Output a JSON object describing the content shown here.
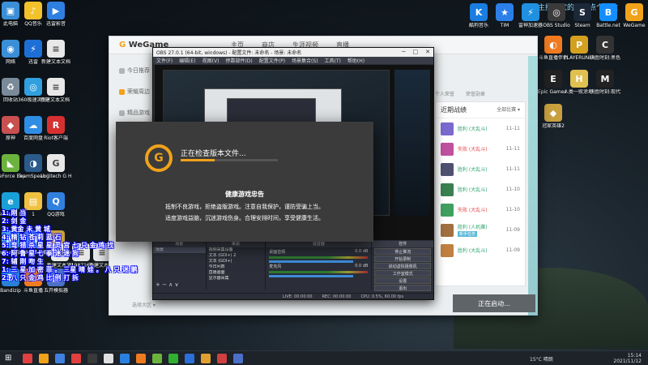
{
  "banner": {
    "text": "曾洁主播喜欢的可以点个关注"
  },
  "desktop_left": [
    {
      "label": "此电脑",
      "color": "#3a8fd6",
      "glyph": "▣"
    },
    {
      "label": "QQ音乐",
      "color": "#f3c12b",
      "glyph": "♪"
    },
    {
      "label": "迅雷影音",
      "color": "#2f7fe0",
      "glyph": "▶"
    },
    {
      "label": "网络",
      "color": "#3a8fd6",
      "glyph": "◉"
    },
    {
      "label": "迅雷",
      "color": "#1d6fd6",
      "glyph": "⚡"
    },
    {
      "label": "新建文本文档",
      "color": "#e8e8e8",
      "glyph": "≡"
    },
    {
      "label": "回收站",
      "color": "#7a8a99",
      "glyph": "♻"
    },
    {
      "label": "360极速浏览器",
      "color": "#30a0e0",
      "glyph": "◎"
    },
    {
      "label": "新建文本文档 (2)",
      "color": "#e8e8e8",
      "glyph": "≡"
    },
    {
      "label": "原神",
      "color": "#c85050",
      "glyph": "◆"
    },
    {
      "label": "百度网盘",
      "color": "#2f8de4",
      "glyph": "☁"
    },
    {
      "label": "Riot客户端",
      "color": "#d73030",
      "glyph": "R"
    },
    {
      "label": "GeForce Experience",
      "color": "#6cb33e",
      "glyph": "◣"
    },
    {
      "label": "TeamSpeak 3",
      "color": "#2a5b8a",
      "glyph": "◑"
    },
    {
      "label": "Logitech G HUB",
      "color": "#e8e8e8",
      "glyph": "G"
    },
    {
      "label": "Microsoft Edge",
      "color": "#1aa0d8",
      "glyph": "e"
    },
    {
      "label": "1",
      "color": "#f0c040",
      "glyph": "▤"
    },
    {
      "label": "QQ游戏",
      "color": "#3080e0",
      "glyph": "Q"
    },
    {
      "label": "MuMu模拟器",
      "color": "#4aa0e8",
      "glyph": "M"
    },
    {
      "label": "MuMu多开器",
      "color": "#4a8ae8",
      "glyph": "M"
    },
    {
      "label": "League of Legends",
      "color": "#c8a040",
      "glyph": "L"
    },
    {
      "label": "Bandizip",
      "color": "#2a80d8",
      "glyph": "B"
    },
    {
      "label": "斗鱼直播",
      "color": "#f07a20",
      "glyph": "◐"
    },
    {
      "label": "五开模拟器",
      "color": "#4a70c8",
      "glyph": "▦"
    }
  ],
  "desktop_middle": [
    {
      "label": "新建文本文档 (2)"
    },
    {
      "label": "d198716dcf5..."
    },
    {
      "label": "新建文本文档"
    }
  ],
  "desktop_top_right": [
    {
      "label": "酷狗音乐",
      "color": "#1a7de0",
      "glyph": "K"
    },
    {
      "label": "TIM",
      "color": "#2d7fe8",
      "glyph": "★"
    },
    {
      "label": "雷神加速器",
      "color": "#2090e0",
      "glyph": "⚡"
    },
    {
      "label": "OBS Studio",
      "color": "#3a3a3a",
      "glyph": "◎"
    },
    {
      "label": "Steam",
      "color": "#1b2838",
      "glyph": "S"
    },
    {
      "label": "Battle.net",
      "color": "#148eff",
      "glyph": "B"
    },
    {
      "label": "WeGame",
      "color": "#f0a21a",
      "glyph": "G"
    }
  ],
  "desktop_right": [
    {
      "label": "斗鱼直播伴侣",
      "color": "#f07a20",
      "glyph": "◐"
    },
    {
      "label": "PLAYERUNKNOWN'S BATTLEGR...",
      "color": "#d4a020",
      "glyph": "P"
    },
    {
      "label": "决胜时刻:黑色行动冷战",
      "color": "#333",
      "glyph": "C"
    },
    {
      "label": "Epic Games Launcher",
      "color": "#222",
      "glyph": "E"
    },
    {
      "label": "人类一败涂地 Human Fall Flat",
      "color": "#e0c050",
      "glyph": "H"
    },
    {
      "label": "决胜时刻:现代战争",
      "color": "#222",
      "glyph": "M"
    },
    {
      "label": "冠家英雄2",
      "color": "#c8a040",
      "glyph": "◆"
    }
  ],
  "overlay_lines": [
    "1: 刚  当",
    "2: 剑  金",
    "3: 黄金  未  黄  城",
    "4: 精  钻  苍  莉  蓝  石",
    "5:  弯  猎  杀  星  星  灵  宫  七  只  金  鸡  找",
    "6: 阿  鲁  星  七  拳  迷  迷  狗",
    "7: 辅  刚  吻  生",
    "1: 三  星  加  密  菲  。 三星  晴  娃 。 八  只  迷  鹏",
    "2:  八  只  金  鸡  比  例  打  拆"
  ],
  "wegame": {
    "logo": "WeGame",
    "tabs": [
      "主页",
      "商店",
      "生涯视频",
      "直播"
    ],
    "side": [
      "今日推荐",
      "荣耀周边",
      "精品游戏",
      "LOL大乱斗",
      "游戏中心"
    ],
    "right_tabs": [
      "个人荣誉",
      "荣誉勋章"
    ],
    "recent_title": "近期战绩",
    "filter": "全部比赛 ▾",
    "matches": [
      {
        "result": "胜利 (大乱斗)",
        "outcome": "win",
        "date": "11-11",
        "color": "#7a6ad0"
      },
      {
        "result": "失败 (大乱斗)",
        "outcome": "lose",
        "date": "11-11",
        "color": "#c050a0"
      },
      {
        "result": "胜利 (大乱斗)",
        "outcome": "win",
        "date": "11-11",
        "color": "#505070"
      },
      {
        "result": "胜利 (大乱斗)",
        "outcome": "win",
        "date": "11-10",
        "color": "#3a8050"
      },
      {
        "result": "失败 (大乱斗)",
        "outcome": "lose",
        "date": "11-10",
        "color": "#40a060"
      },
      {
        "result": "胜利 (人机赛)",
        "outcome": "win",
        "date": "11-09",
        "color": "#a07040",
        "tag": "新手任务"
      },
      {
        "result": "胜利 (大乱斗)",
        "outcome": "win",
        "date": "11-09",
        "color": "#c08040"
      }
    ],
    "start_button": "正在启动...",
    "bottom_hint": "选择大区  ▾"
  },
  "obs": {
    "title": "OBS 27.0.1 (64-bit, windows) - 配置文件: 未命名 - 场景: 未命名",
    "menu": [
      "文件(F)",
      "编辑(E)",
      "视图(V)",
      "停靠部件(D)",
      "配置文件(P)",
      "场景集合(S)",
      "工具(T)",
      "帮助(H)"
    ],
    "panels": {
      "scenes_header": "场景",
      "scenes": [
        "场景"
      ],
      "sources_header": "来源",
      "sources": [
        "视频采集设备",
        "文本 (GDI+) 2",
        "文本 (GDI+)",
        "今日问数",
        "直播画面",
        "显示器采集"
      ],
      "mixer_header": "混音器",
      "mixer": [
        {
          "name": "桌面音频",
          "db": "0.0 dB"
        },
        {
          "name": "麦克风",
          "db": "0.0 dB"
        }
      ],
      "transitions_header": "转场特效",
      "controls_header": "控件",
      "controls": [
        "停止推流",
        "开始录制",
        "启动虚拟摄像机",
        "工作室模式",
        "设置",
        "退出"
      ]
    },
    "status": [
      "LIVE: 00:00:00",
      "REC: 00:00:00",
      "CPU: 0.5%, 60.00 fps"
    ]
  },
  "dialog": {
    "status": "正在检查版本文件...",
    "progress": 0.35,
    "heading": "健康游戏忠告",
    "line1": "抵制不良游戏，拒绝盗版游戏。注意自我保护，谨防受骗上当。",
    "line2": "适度游戏益脑，沉迷游戏伤身。合理安排时间，享受健康生活。"
  },
  "taskbar": {
    "weather": "15°C 晴朗",
    "time": "15:14",
    "date": "2021/11/12",
    "apps": [
      "#e04040",
      "#f0a21a",
      "#4080e0",
      "#e04040",
      "#3a3a3a",
      "#e0e0e0",
      "#2a80e0",
      "#f07a20",
      "#6cb33e",
      "#30b030",
      "#2a70d8",
      "#e0a030",
      "#d04040",
      "#4a70c8"
    ]
  }
}
